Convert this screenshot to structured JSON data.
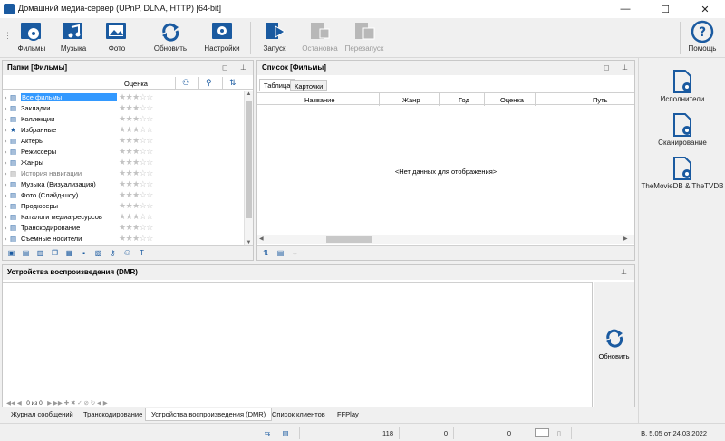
{
  "window": {
    "title": "Домашний медиа-сервер (UPnP, DLNA, HTTP) [64-bit]"
  },
  "toolbar": {
    "films": "Фильмы",
    "music": "Музыка",
    "photo": "Фото",
    "refresh": "Обновить",
    "settings": "Настройки",
    "start": "Запуск",
    "stop": "Остановка",
    "restart": "Перезапуск",
    "help": "Помощь"
  },
  "folders": {
    "title": "Папки [Фильмы]",
    "rating_header": "Оценка",
    "items": [
      "Все фильмы",
      "Закладки",
      "Коллекции",
      "Избранные",
      "Актеры",
      "Режиссеры",
      "Жанры",
      "История навигации",
      "Музыка (Визуализация)",
      "Фото (Слайд-шоу)",
      "Продюсеры",
      "Каталоги медиа-ресурсов",
      "Транскодирование",
      "Съемные носители"
    ]
  },
  "list": {
    "title": "Список [Фильмы]",
    "tab_table": "Таблица",
    "tab_cards": "Карточки",
    "col_name": "Название",
    "col_genre": "Жанр",
    "col_year": "Год",
    "col_rating": "Оценка",
    "col_path": "Путь",
    "empty": "<Нет данных для отображения>"
  },
  "dmr": {
    "title": "Устройства воспроизведения (DMR)",
    "refresh": "Обновить",
    "pager": "0 из 0"
  },
  "side": {
    "performers": "Исполнители",
    "scan": "Сканирование",
    "tmdb": "TheMovieDB & TheTVDB"
  },
  "tabs": [
    "Журнал сообщений",
    "Транскодирование",
    "Устройства воспроизведения (DMR)",
    "Список клиентов",
    "FFPlay"
  ],
  "status": {
    "count": "118",
    "v1": "0",
    "v2": "0",
    "version": "В. 5.05 от 24.03.2022"
  },
  "colors": {
    "accent": "#1a5aa0",
    "selection": "#3399ff"
  }
}
